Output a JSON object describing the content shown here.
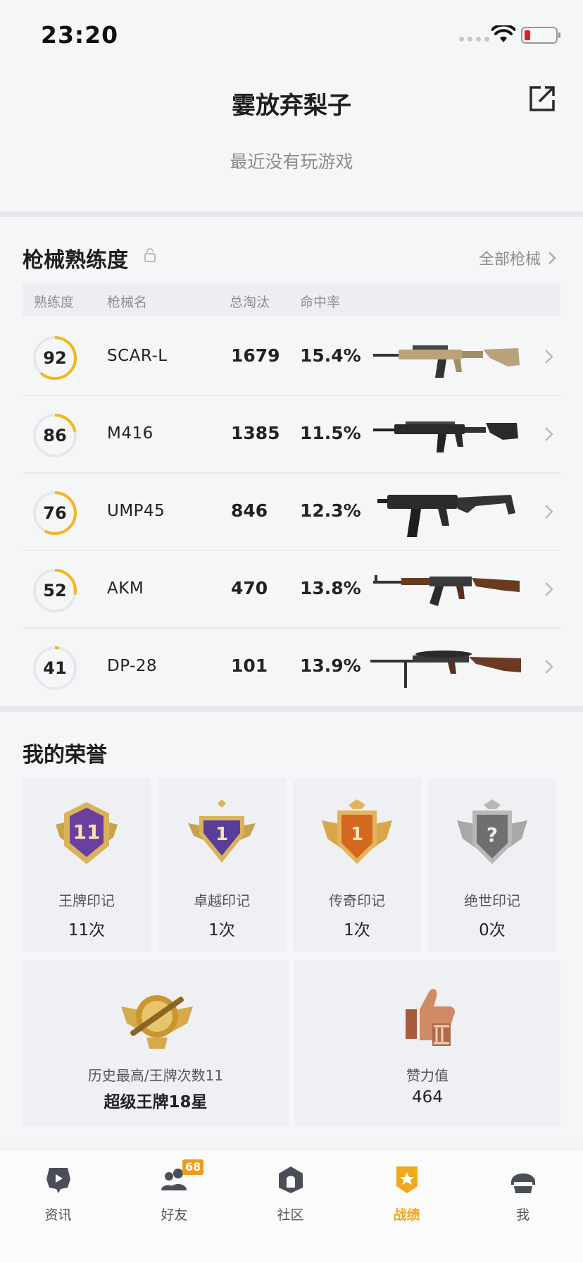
{
  "status_bar": {
    "time": "23:20"
  },
  "header": {
    "player_name": "霎放弃梨子",
    "status": "最近没有玩游戏"
  },
  "weapons": {
    "title": "枪械熟练度",
    "all_link": "全部枪械",
    "columns": {
      "proficiency": "熟练度",
      "name": "枪械名",
      "kills": "总淘汰",
      "accuracy": "命中率"
    },
    "rows": [
      {
        "proficiency": "92",
        "level_fraction": 0.62,
        "name": "SCAR-L",
        "kills": "1679",
        "accuracy": "15.4%"
      },
      {
        "proficiency": "86",
        "level_fraction": 0.22,
        "name": "M416",
        "kills": "1385",
        "accuracy": "11.5%"
      },
      {
        "proficiency": "76",
        "level_fraction": 0.58,
        "name": "UMP45",
        "kills": "846",
        "accuracy": "12.3%"
      },
      {
        "proficiency": "52",
        "level_fraction": 0.28,
        "name": "AKM",
        "kills": "470",
        "accuracy": "13.8%"
      },
      {
        "proficiency": "41",
        "level_fraction": 0.03,
        "name": "DP-28",
        "kills": "101",
        "accuracy": "13.9%"
      }
    ]
  },
  "honors": {
    "title": "我的荣誉",
    "cards": [
      {
        "label": "王牌印记",
        "count": "11次",
        "badge_text": "11",
        "color": "#6a3fa0"
      },
      {
        "label": "卓越印记",
        "count": "1次",
        "badge_text": "1",
        "color": "#5a3d9a"
      },
      {
        "label": "传奇印记",
        "count": "1次",
        "badge_text": "1",
        "color": "#d2691e"
      },
      {
        "label": "绝世印记",
        "count": "0次",
        "badge_text": "?",
        "color": "#8a8a8a"
      }
    ],
    "rank": {
      "label": "历史最高/王牌次数11",
      "value": "超级王牌18星"
    },
    "likes": {
      "label": "赞力值",
      "value": "464"
    }
  },
  "nav": {
    "items": [
      {
        "label": "资讯",
        "icon": "news-icon"
      },
      {
        "label": "好友",
        "icon": "friends-icon",
        "badge": "68"
      },
      {
        "label": "社区",
        "icon": "community-icon"
      },
      {
        "label": "战绩",
        "icon": "record-icon",
        "active": true
      },
      {
        "label": "我",
        "icon": "me-icon"
      }
    ]
  },
  "colors": {
    "accent": "#f5b51a",
    "ring_track": "#e6e7ea",
    "nav_active": "#f0a81c"
  }
}
